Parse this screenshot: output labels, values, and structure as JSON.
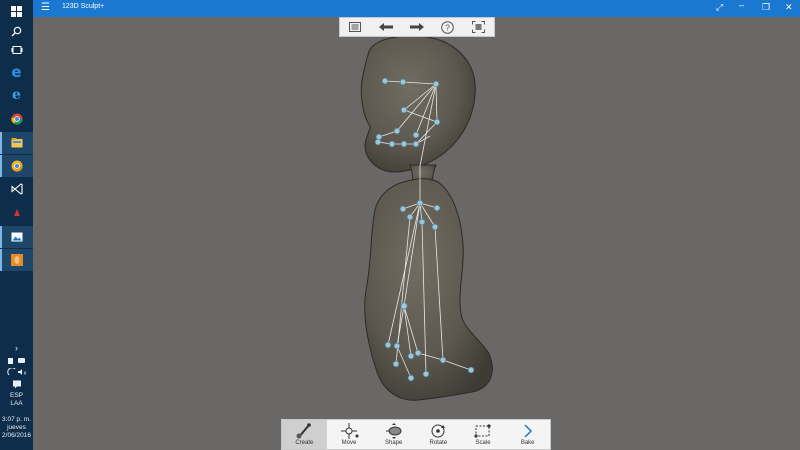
{
  "window": {
    "title": "123D Sculpt+",
    "menu_icon": "hamburger-icon",
    "controls": [
      "restore-icon",
      "minimize-icon",
      "maximize-icon",
      "close-icon"
    ]
  },
  "taskbar": {
    "items": [
      "windows-start-icon",
      "search-icon",
      "task-view-icon",
      "edge-icon",
      "ie-icon",
      "chrome-icon",
      "file-explorer-icon",
      "chrome-canary-icon",
      "visual-studio-icon",
      "app-red-icon",
      "photos-icon",
      "sculpt-app-icon"
    ],
    "tray": {
      "language_line1": "ESP",
      "language_line2": "LAA",
      "time": "3:07 p. m.",
      "day": "jueves",
      "date": "2/06/2016"
    }
  },
  "top_toolbar": {
    "buttons": [
      "gallery-icon",
      "undo-arrow-icon",
      "redo-arrow-icon",
      "help-icon",
      "frame-icon"
    ]
  },
  "bottom_toolbar": {
    "buttons": [
      {
        "label": "Create",
        "icon": "create-icon",
        "selected": true
      },
      {
        "label": "Move",
        "icon": "move-icon",
        "selected": false
      },
      {
        "label": "Shape",
        "icon": "shape-icon",
        "selected": false
      },
      {
        "label": "Rotate",
        "icon": "rotate-icon",
        "selected": false
      },
      {
        "label": "Scale",
        "icon": "scale-icon",
        "selected": false
      },
      {
        "label": "Bake",
        "icon": "chevron-right-icon",
        "selected": false
      }
    ]
  },
  "colors": {
    "taskbar_bg": "#0d2d4a",
    "titlebar_bg": "#1a78d0",
    "viewport_bg": "#696866",
    "model_fill": "#5e5a50",
    "skeleton_line": "#e8e8e8",
    "joint_fill": "#9cc8dc"
  }
}
